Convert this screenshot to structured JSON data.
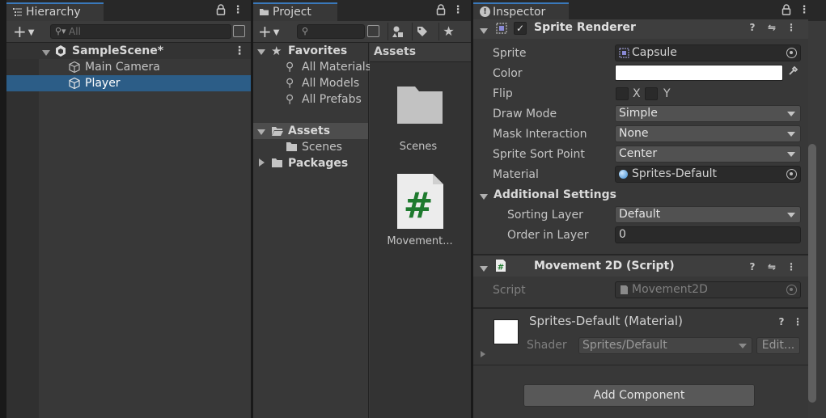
{
  "hierarchy": {
    "tab_label": "Hierarchy",
    "search_placeholder": "All",
    "scene_name": "SampleScene*",
    "objects": [
      {
        "name": "Main Camera",
        "selected": false
      },
      {
        "name": "Player",
        "selected": true
      }
    ]
  },
  "project": {
    "tab_label": "Project",
    "favorites_label": "Favorites",
    "favorites": [
      "All Materials",
      "All Models",
      "All Prefabs"
    ],
    "assets_label": "Assets",
    "asset_folders": [
      "Scenes"
    ],
    "packages_label": "Packages",
    "grid_header": "Assets",
    "grid_items": [
      {
        "name": "Scenes",
        "icon": "folder-icon"
      },
      {
        "name": "Movement...",
        "icon": "csharp-script-icon"
      }
    ]
  },
  "inspector": {
    "tab_label": "Inspector",
    "sprite_renderer": {
      "title": "Sprite Renderer",
      "sprite_label": "Sprite",
      "sprite_value": "Capsule",
      "color_label": "Color",
      "color_value": "#FFFFFF",
      "flip_label": "Flip",
      "flip_x": "X",
      "flip_y": "Y",
      "draw_mode_label": "Draw Mode",
      "draw_mode_value": "Simple",
      "mask_label": "Mask Interaction",
      "mask_value": "None",
      "sort_point_label": "Sprite Sort Point",
      "sort_point_value": "Center",
      "material_label": "Material",
      "material_value": "Sprites-Default",
      "additional_label": "Additional Settings",
      "sorting_layer_label": "Sorting Layer",
      "sorting_layer_value": "Default",
      "order_label": "Order in Layer",
      "order_value": "0"
    },
    "script_component": {
      "title": "Movement 2D (Script)",
      "script_label": "Script",
      "script_value": "Movement2D"
    },
    "material": {
      "title": "Sprites-Default (Material)",
      "shader_label": "Shader",
      "shader_value": "Sprites/Default",
      "edit_label": "Edit..."
    },
    "add_component_label": "Add Component"
  },
  "colors": {
    "accent": "#3a79bb",
    "selection": "#2c5d87",
    "panel": "#383838",
    "script_icon_green": "#1e7a2e"
  }
}
